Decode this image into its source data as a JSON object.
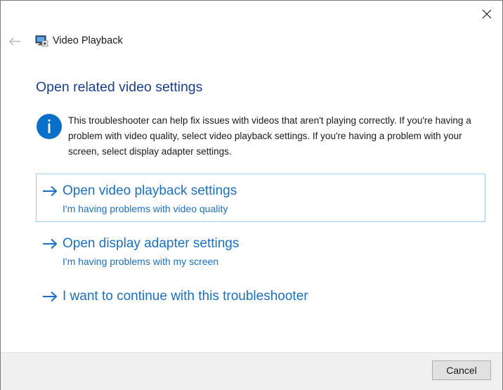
{
  "window": {
    "title": "Video Playback",
    "close_icon": "close-icon",
    "back_icon": "back-arrow-icon",
    "app_icon": "video-playback-icon"
  },
  "content": {
    "heading": "Open related video settings",
    "info_icon": "info-icon",
    "description": "This troubleshooter can help fix issues with videos that aren't playing correctly. If you're having a problem with video quality, select video playback settings. If you're having a problem with your screen, select display adapter settings.",
    "options": [
      {
        "title": "Open video playback settings",
        "subtitle": "I'm having problems with video quality",
        "focused": true
      },
      {
        "title": "Open display adapter settings",
        "subtitle": "I'm having problems with my screen",
        "focused": false
      },
      {
        "title": "I want to continue with this troubleshooter",
        "subtitle": "",
        "focused": false
      }
    ]
  },
  "footer": {
    "cancel_label": "Cancel"
  },
  "colors": {
    "heading": "#1a3e8a",
    "link": "#1a70c2",
    "info_icon": "#0a6fc9",
    "focus_border": "#9fcbec",
    "footer_bg": "#f0f0f0"
  }
}
